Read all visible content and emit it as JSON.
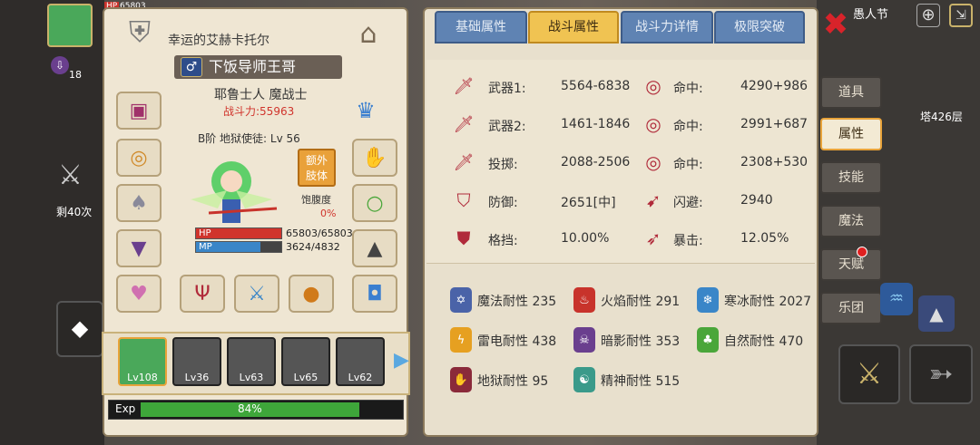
{
  "hero": {
    "portrait_hp_label": "HP",
    "hp_top": "65803",
    "level_bubble": "18",
    "remaining": "剩40次",
    "title": "幸运的艾赫卡托尔",
    "nickname": "下饭导师王哥",
    "race_class": "耶鲁士人 魔战士",
    "power_label": "战斗力:55963",
    "tier_line": "B阶 地狱使徒: Lv 56",
    "extra_body_btn": "额外\n肢体",
    "hunger_label": "饱腹度",
    "hunger_value": "0%",
    "hp_bar_label": "HP",
    "hp_bar_value": "65803/65803",
    "mp_bar_label": "MP",
    "mp_bar_value": "3624/4832",
    "exp_label": "Exp",
    "exp_percent": "84%",
    "exp_fraction": 0.84,
    "hp_fraction": 1.0,
    "mp_fraction": 0.75
  },
  "party": [
    {
      "level": "Lv108"
    },
    {
      "level": "Lv36"
    },
    {
      "level": "Lv63"
    },
    {
      "level": "Lv65"
    },
    {
      "level": "Lv62"
    }
  ],
  "tabs": [
    {
      "label": "基础属性"
    },
    {
      "label": "战斗属性"
    },
    {
      "label": "战斗力详情"
    },
    {
      "label": "极限突破"
    }
  ],
  "stats_left": [
    {
      "label": "武器1:",
      "value": "5564-6838",
      "icon": "sword-icon"
    },
    {
      "label": "武器2:",
      "value": "1461-1846",
      "icon": "sword-icon"
    },
    {
      "label": "投掷:",
      "value": "2088-2506",
      "icon": "throw-icon"
    },
    {
      "label": "防御:",
      "value": "2651[中]",
      "icon": "shield-icon"
    },
    {
      "label": "格挡:",
      "value": "10.00%",
      "icon": "block-icon"
    }
  ],
  "stats_right": [
    {
      "label": "命中:",
      "value": "4290+986",
      "icon": "target-icon"
    },
    {
      "label": "命中:",
      "value": "2991+687",
      "icon": "target-icon"
    },
    {
      "label": "命中:",
      "value": "2308+530",
      "icon": "target-icon"
    },
    {
      "label": "闪避:",
      "value": "2940",
      "icon": "dodge-icon"
    },
    {
      "label": "暴击:",
      "value": "12.05%",
      "icon": "crit-icon"
    }
  ],
  "resistances": [
    {
      "label": "魔法耐性 235",
      "color": "#4a63a8",
      "icon": "magic-resist-icon"
    },
    {
      "label": "火焰耐性 291",
      "color": "#c8332b",
      "icon": "fire-resist-icon"
    },
    {
      "label": "寒冰耐性 2027",
      "color": "#3a86c8",
      "icon": "ice-resist-icon"
    },
    {
      "label": "雷电耐性 438",
      "color": "#e6a021",
      "icon": "thunder-resist-icon"
    },
    {
      "label": "暗影耐性 353",
      "color": "#6a3f8e",
      "icon": "shadow-resist-icon"
    },
    {
      "label": "自然耐性 470",
      "color": "#4aa63a",
      "icon": "nature-resist-icon"
    },
    {
      "label": "地狱耐性 95",
      "color": "#8a2a3a",
      "icon": "hell-resist-icon"
    },
    {
      "label": "精神耐性 515",
      "color": "#3a9a8a",
      "icon": "spirit-resist-icon"
    }
  ],
  "side_tabs": [
    {
      "label": "道具"
    },
    {
      "label": "属性"
    },
    {
      "label": "技能"
    },
    {
      "label": "魔法"
    },
    {
      "label": "天赋"
    },
    {
      "label": "乐团"
    }
  ],
  "top_right": {
    "player_name": "愚人节",
    "tower": "塔426层"
  },
  "colors": {
    "accent": "#f0c352",
    "tab_blue": "#5f83b3",
    "power_red": "#d0342c",
    "exp_green": "#3ea63a"
  }
}
